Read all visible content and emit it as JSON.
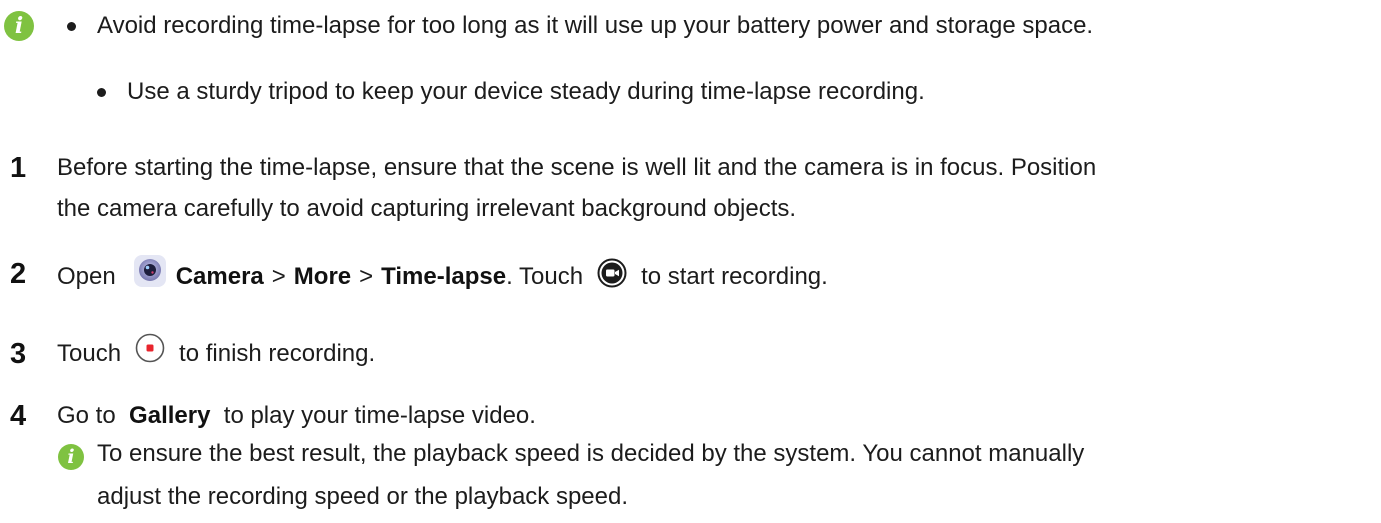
{
  "notes": {
    "icon": "info-icon",
    "items": [
      "Avoid recording time-lapse for too long as it will use up your battery power and storage space.",
      "Use a sturdy tripod to keep your device steady during time-lapse recording."
    ]
  },
  "steps": [
    {
      "number": "1",
      "lines": [
        "Before starting the time-lapse, ensure that the scene is well lit and the camera is in focus. Position",
        "the camera carefully to avoid capturing irrelevant background objects."
      ]
    },
    {
      "number": "2",
      "open": "Open",
      "camera_icon": "camera-app-icon",
      "camera": "Camera",
      "sep1": ">",
      "more": "More",
      "sep2": ">",
      "timelapse": "Time-lapse",
      "touch": ". Touch",
      "record_icon": "video-record-icon",
      "tail": "to start recording."
    },
    {
      "number": "3",
      "touch": "Touch",
      "stop_icon": "stop-record-icon",
      "tail": "to finish recording."
    },
    {
      "number": "4",
      "go_to": "Go to",
      "gallery": "Gallery",
      "tail": "to play your time-lapse video."
    }
  ],
  "step4_note": {
    "icon": "info-icon",
    "lines": [
      "To ensure the best result, the playback speed is decided by the system. You cannot manually",
      "adjust the recording speed or the playback speed."
    ]
  },
  "colors": {
    "info_icon": "#7fc241",
    "text": "#1c1c1c",
    "stop_red": "#e8242d"
  }
}
